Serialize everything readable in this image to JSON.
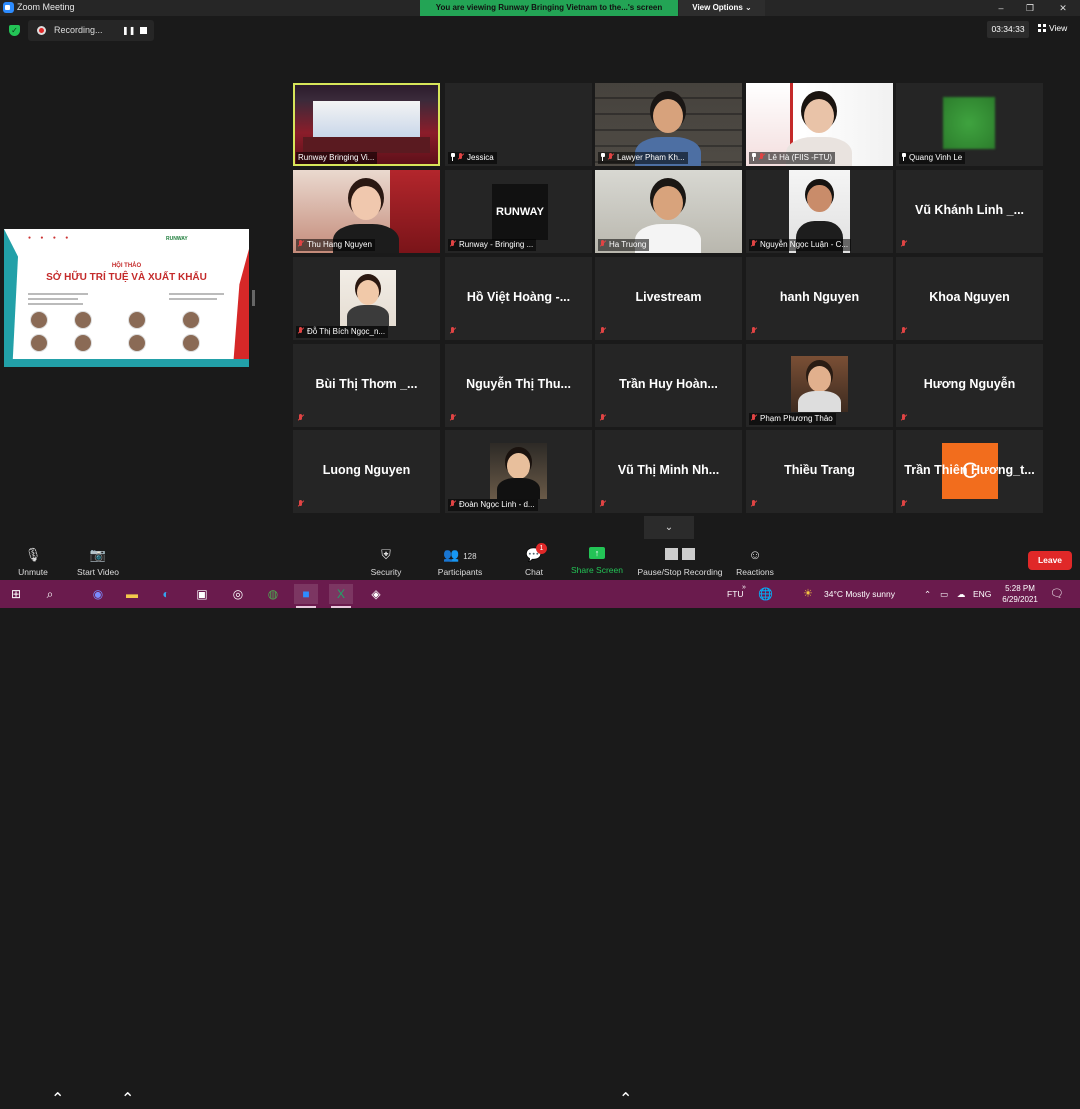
{
  "titlebar": {
    "app_title": "Zoom Meeting",
    "share_banner": "You are viewing Runway Bringing Vietnam to the...'s screen",
    "view_options": "View Options ⌄",
    "minimize": "–",
    "restore": "❐",
    "close": "✕"
  },
  "recording": {
    "status": "Recording...",
    "pause": "❚❚",
    "timer": "03:34:33",
    "view_label": "View"
  },
  "shared_screen": {
    "subtitle": "HỘI THẢO",
    "title": "SỞ HỮU TRÍ TUỆ VÀ XUẤT KHẨU",
    "brand": "RUNWAY"
  },
  "participants": [
    {
      "name": "Runway Bringing Vi...",
      "muted": false,
      "pinned": false,
      "video": true,
      "active": true
    },
    {
      "name": "Jessica",
      "muted": true,
      "pinned": true,
      "video": true
    },
    {
      "name": "Lawyer Pham Kh...",
      "muted": true,
      "pinned": true,
      "video": true
    },
    {
      "name": "Lê Hà (FIIS -FTU)",
      "muted": true,
      "pinned": true,
      "video": true
    },
    {
      "name": "Quang Vinh Le",
      "muted": false,
      "pinned": true,
      "video": true
    },
    {
      "name": "Thu Hang Nguyen",
      "muted": true,
      "pinned": false,
      "video": true
    },
    {
      "name": "Runway - Bringing ...",
      "muted": true,
      "pinned": false,
      "video": true,
      "logo": "RUNWAY"
    },
    {
      "name": "Ha Truong",
      "muted": true,
      "pinned": false,
      "video": true
    },
    {
      "name": "Nguyễn Ngọc Luận - C...",
      "muted": true,
      "pinned": false,
      "video": true
    },
    {
      "name": "Vũ Khánh Linh _...",
      "muted": true,
      "pinned": false,
      "video": false
    },
    {
      "name": "Đỗ Thị Bích Ngọc_n...",
      "muted": true,
      "pinned": false,
      "video": true
    },
    {
      "name": "Hồ Việt Hoàng -...",
      "muted": true,
      "pinned": false,
      "video": false
    },
    {
      "name": "Livestream",
      "muted": true,
      "pinned": false,
      "video": false
    },
    {
      "name": "hanh Nguyen",
      "muted": true,
      "pinned": false,
      "video": false
    },
    {
      "name": "Khoa Nguyen",
      "muted": true,
      "pinned": false,
      "video": false
    },
    {
      "name": "Bùi Thị Thơm _...",
      "muted": true,
      "pinned": false,
      "video": false
    },
    {
      "name": "Nguyễn Thị Thu...",
      "muted": true,
      "pinned": false,
      "video": false
    },
    {
      "name": "Trần Huy Hoàn...",
      "muted": true,
      "pinned": false,
      "video": false
    },
    {
      "name": "Phạm Phương Thảo",
      "muted": true,
      "pinned": false,
      "video": true
    },
    {
      "name": "Hương Nguyễn",
      "muted": true,
      "pinned": false,
      "video": false
    },
    {
      "name": "Luong Nguyen",
      "muted": true,
      "pinned": false,
      "video": false
    },
    {
      "name": "Đoàn Ngọc Linh - d...",
      "muted": true,
      "pinned": false,
      "video": true
    },
    {
      "name": "Vũ Thị Minh Nh...",
      "muted": true,
      "pinned": false,
      "video": false
    },
    {
      "name": "Thiều Trang",
      "muted": true,
      "pinned": false,
      "video": false
    },
    {
      "name": "Trần Thiên Hương_t...",
      "muted": true,
      "pinned": false,
      "video": false,
      "initial": "C"
    }
  ],
  "collapse_label": "⌄",
  "toolbar": {
    "unmute": "Unmute",
    "start_video": "Start Video",
    "security": "Security",
    "participants": "Participants",
    "participants_count": "128",
    "chat": "Chat",
    "chat_badge": "1",
    "share_screen": "Share Screen",
    "pause_stop_recording": "Pause/Stop Recording",
    "reactions": "Reactions",
    "leave": "Leave"
  },
  "taskbar": {
    "keyboard_hint": "FTU",
    "weather": "34°C  Mostly sunny",
    "language": "ENG",
    "time": "5:28 PM",
    "date": "6/29/2021",
    "overflow": "»"
  },
  "colors": {
    "zoom_blue": "#2d8cff",
    "banner_green": "#23a455",
    "leave_red": "#e02828",
    "active_speaker": "#d7e55a",
    "taskbar": "#6a1b4d"
  }
}
